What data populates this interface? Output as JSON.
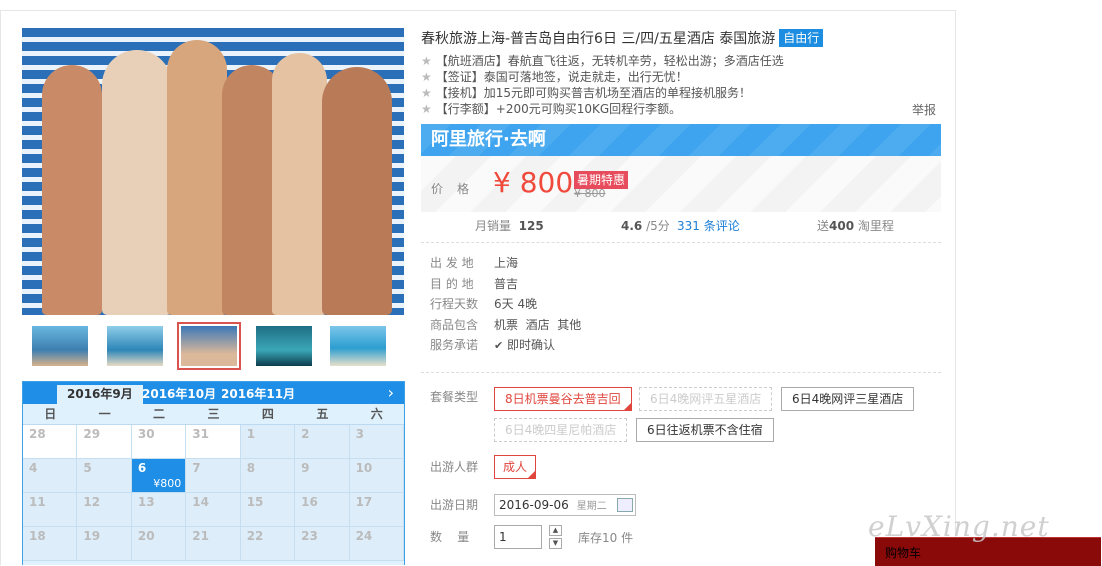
{
  "product": {
    "title": "春秋旅游上海-普吉岛自由行6日 三/四/五星酒店 泰国旅游",
    "tag": "自由行",
    "features": [
      {
        "key": "【航班酒店】",
        "text": "春航直飞往返，无转机辛劳，轻松出游；多酒店任选"
      },
      {
        "key": "【签证】",
        "text": "泰国可落地签，说走就走，出行无忧！"
      },
      {
        "key": "【接机】",
        "text": "加15元即可购买普吉机场至酒店的单程接机服务！"
      },
      {
        "key": "【行李额】",
        "text": "+200元可购买10KG回程行李额。"
      }
    ],
    "star_glyph": "★",
    "report": "举报"
  },
  "banner": {
    "brand": "阿里旅行·去啊",
    "price_label": "价格",
    "price": "¥ 800",
    "promo": "暑期特惠",
    "old_price": "¥ 800"
  },
  "stats": {
    "sales_label": "月销量",
    "sales": "125",
    "rating": "4.6",
    "rating_suffix": "/5分",
    "reviews": "331 条评论",
    "points_prefix": "送",
    "points": "400",
    "points_suffix": "淘里程"
  },
  "info": [
    {
      "label": "出 发 地",
      "value": "上海"
    },
    {
      "label": "目 的 地",
      "value": "普吉"
    },
    {
      "label": "行程天数",
      "value": "6天 4晚"
    },
    {
      "label": "商品包含",
      "value": "机票  酒店  其他"
    },
    {
      "label": "服务承诺",
      "value": "即时确认"
    }
  ],
  "package": {
    "label": "套餐类型",
    "options": [
      {
        "label": "8日机票曼谷去普吉回",
        "state": "selected"
      },
      {
        "label": "6日4晚网评五星酒店",
        "state": "disabled"
      },
      {
        "label": "6日4晚网评三星酒店",
        "state": "normal"
      },
      {
        "label": "6日4晚四星尼帕酒店",
        "state": "disabled"
      },
      {
        "label": "6日往返机票不含住宿",
        "state": "normal"
      }
    ]
  },
  "travelers": {
    "label": "出游人群",
    "option": "成人"
  },
  "date": {
    "label": "出游日期",
    "value": "2016-09-06",
    "weekday": "星期二"
  },
  "quantity": {
    "label": "数    量",
    "value": "1",
    "up": "▲",
    "down": "▼",
    "stock": "库存10 件"
  },
  "calendar": {
    "tabs": [
      "2016年9月",
      "2016年10月",
      "2016年11月"
    ],
    "next": "›",
    "weekdays": [
      "日",
      "一",
      "二",
      "三",
      "四",
      "五",
      "六"
    ],
    "rows": [
      [
        "28",
        "29",
        "30",
        "31",
        "1",
        "2",
        "3"
      ],
      [
        "4",
        "5",
        "6",
        "7",
        "8",
        "9",
        "10"
      ],
      [
        "11",
        "12",
        "13",
        "14",
        "15",
        "16",
        "17"
      ],
      [
        "18",
        "19",
        "20",
        "21",
        "22",
        "23",
        "24"
      ]
    ],
    "selected_price": "¥800"
  },
  "cart": {
    "label": "购物车"
  },
  "watermark": "eLvXing.net",
  "colors": {
    "accent": "#1f8ee6",
    "price": "#f04a3d",
    "promo": "#e74c5c"
  }
}
